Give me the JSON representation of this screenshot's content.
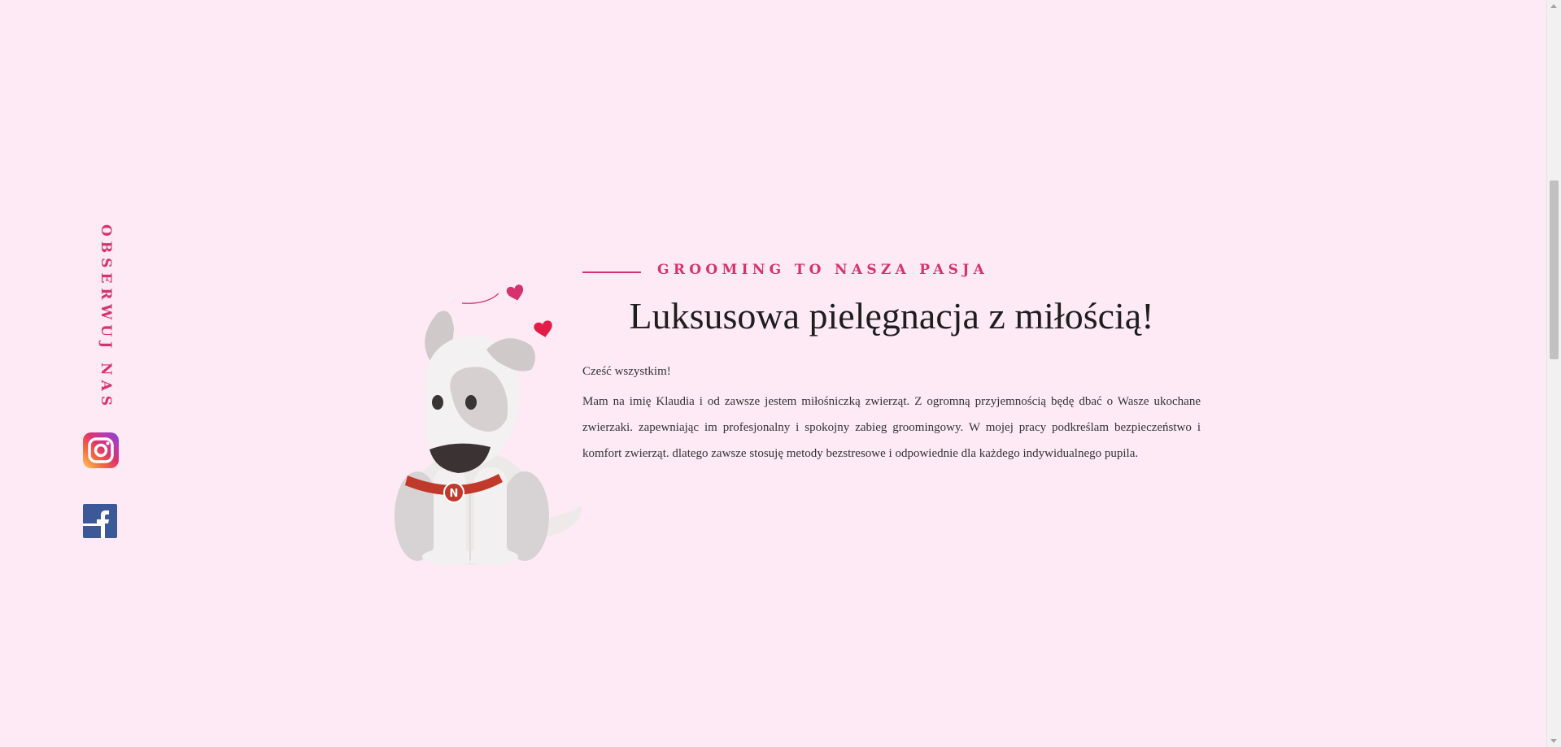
{
  "social": {
    "follow_label": "OBSERWUJ NAS",
    "instagram_icon": "instagram-icon",
    "facebook_icon": "facebook-icon"
  },
  "hero": {
    "eyebrow": "GROOMING TO NASZA PASJA",
    "heading": "Luksusowa pielęgnacja z miłością!",
    "intro": "Cześć wszystkim!",
    "body": "Mam na imię Klaudia i od zawsze jestem miłośniczką zwierząt. Z ogromną przyjemnością będę dbać o Wasze ukochane zwierzaki. zapewniając im profesjonalny i spokojny zabieg groomingowy. W mojej pracy podkreślam bezpieczeństwo i komfort zwierząt. dlatego zawsze stosuję metody bezstresowe i odpowiednie dla każdego indywidualnego pupila.",
    "illustration": "dog-with-hearts-illustration",
    "collar_tag": "N"
  },
  "colors": {
    "background": "#fdeaf4",
    "accent": "#d6336c",
    "text": "#333333",
    "heading": "#1e1e1e"
  }
}
